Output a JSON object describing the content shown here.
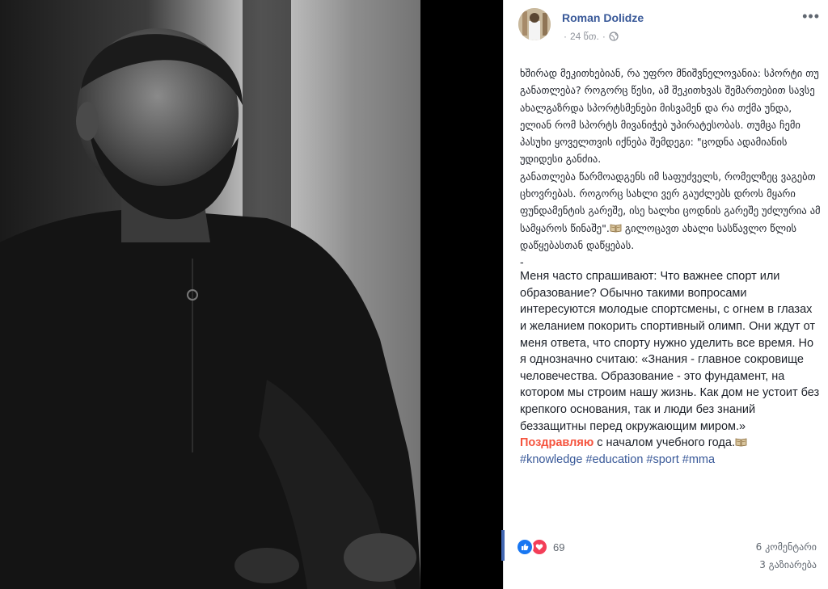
{
  "post": {
    "author": "Roman Dolidze",
    "time": "24 წთ.",
    "georgian_text": "ხშირად მეკითხებიან, რა უფრო მნიშვნელოვანია: სპორტი თუ განათლება? როგორც წესი, ამ შეკითხვას შემართებით სავსე ახალგაზრდა სპორტსმენები მისვამენ და რა თქმა უნდა, ელიან რომ სპორტს მივანიჭებ უპირატესობას. თუმცა ჩემი პასუხი ყოველთვის იქნება შემდეგი: \"ცოდნა ადამიანის უდიდესი განძია.\nგანათლება წარმოადგენს იმ საფუძველს, რომელზეც ვაგებთ ცხოვრებას. როგორც სახლი ვერ გაუძლებს დროს მყარი ფუნდამენტის გარეშე, ისე ხალხი ცოდნის გარეშე უძლურია ამ სამყაროს წინაშე\".",
    "georgian_tail": " გილოცავთ ახალი სასწავლო წლის დაწყებასთან დაწყებას.",
    "separator": "-",
    "russian_text": "Меня часто спрашивают: Что важнее спорт или образование? Обычно такими вопросами интересуются молодые спортсмены, с огнем в глазах и желанием покорить спортивный олимп. Они ждут от меня ответа, что спорту нужно уделить все время. Но я однозначно считаю: «Знания - главное сокровище человечества. Образование - это фундамент, на котором мы строим нашу жизнь. Как дом не устоит без крепкого основания, так и люди без знаний беззащитны перед окружающим миром.»",
    "highlight_word": "Поздравляю",
    "russian_tail": " с началом учебного года.",
    "hashtags": [
      "#knowledge",
      "#education",
      "#sport",
      "#mma"
    ]
  },
  "footer": {
    "reaction_count": "69",
    "comments": "6 კომენტარი",
    "shares": "3 გაზიარება"
  },
  "colors": {
    "link": "#385898",
    "highlight": "#f5533d",
    "like": "#1877f2",
    "love": "#f33e58"
  },
  "icons": [
    "globe-icon",
    "more-dots-icon",
    "book-icon",
    "like-reaction-icon",
    "love-reaction-icon"
  ]
}
